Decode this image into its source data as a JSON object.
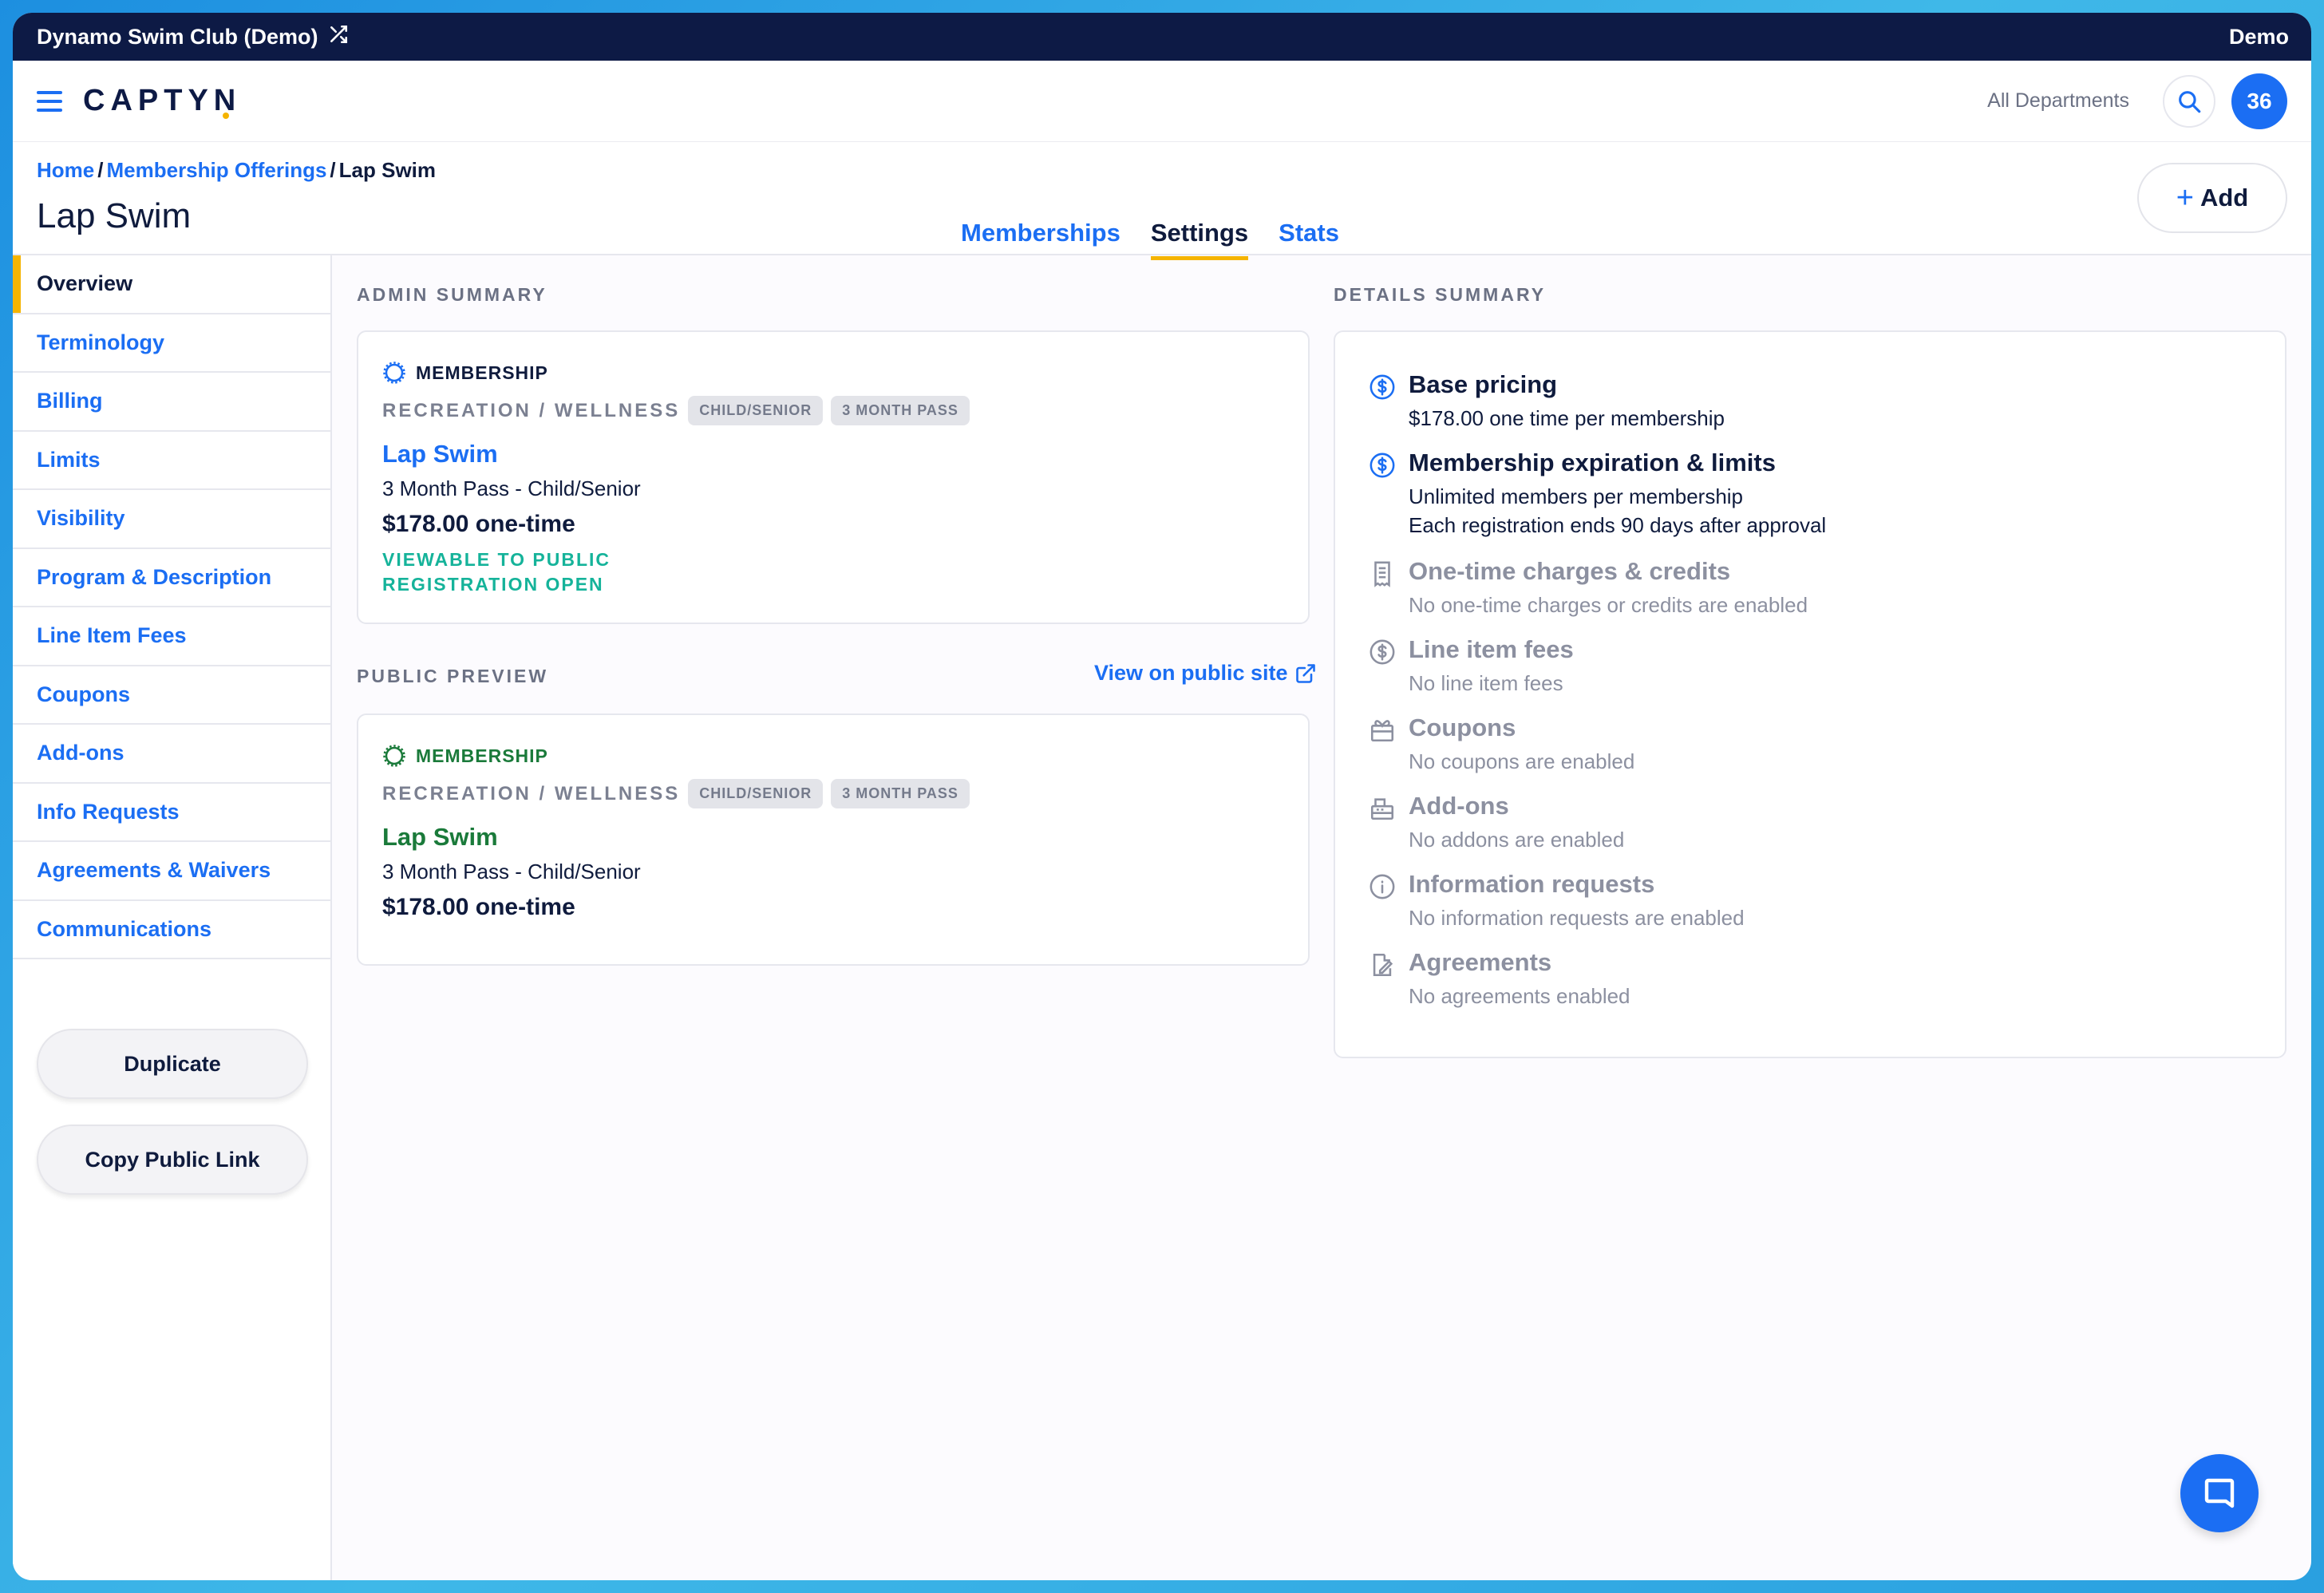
{
  "topbar": {
    "club_name": "Dynamo Swim Club (Demo)",
    "mode": "Demo"
  },
  "appbar": {
    "logo": "CAPTYN",
    "department_filter": "All Departments",
    "notification_count": "36"
  },
  "breadcrumb": {
    "home": "Home",
    "section": "Membership Offerings",
    "current": "Lap Swim"
  },
  "page": {
    "title": "Lap Swim"
  },
  "tabs": [
    {
      "label": "Memberships",
      "active": false
    },
    {
      "label": "Settings",
      "active": true
    },
    {
      "label": "Stats",
      "active": false
    }
  ],
  "add_button": {
    "label": "Add"
  },
  "sidebar": {
    "items": [
      {
        "label": "Overview"
      },
      {
        "label": "Terminology"
      },
      {
        "label": "Billing"
      },
      {
        "label": "Limits"
      },
      {
        "label": "Visibility"
      },
      {
        "label": "Program & Description"
      },
      {
        "label": "Line Item Fees"
      },
      {
        "label": "Coupons"
      },
      {
        "label": "Add-ons"
      },
      {
        "label": "Info Requests"
      },
      {
        "label": "Agreements & Waivers"
      },
      {
        "label": "Communications"
      }
    ],
    "duplicate_label": "Duplicate",
    "copy_link_label": "Copy Public Link"
  },
  "admin_summary": {
    "heading": "ADMIN SUMMARY",
    "type_label": "MEMBERSHIP",
    "category": "RECREATION / WELLNESS",
    "tags": [
      "CHILD/SENIOR",
      "3 MONTH PASS"
    ],
    "title": "Lap Swim",
    "subtitle": "3 Month Pass - Child/Senior",
    "price": "$178.00 one-time",
    "status_visibility": "VIEWABLE TO PUBLIC",
    "status_registration": "REGISTRATION OPEN"
  },
  "public_preview": {
    "heading": "PUBLIC PREVIEW",
    "view_link": "View on public site",
    "type_label": "MEMBERSHIP",
    "category": "RECREATION / WELLNESS",
    "tags": [
      "CHILD/SENIOR",
      "3 MONTH PASS"
    ],
    "title": "Lap Swim",
    "subtitle": "3 Month Pass - Child/Senior",
    "price": "$178.00 one-time"
  },
  "details_summary": {
    "heading": "DETAILS SUMMARY",
    "base_pricing": {
      "title": "Base pricing",
      "text": "$178.00 one time per membership"
    },
    "expiration": {
      "title": "Membership expiration & limits",
      "text1": "Unlimited members per membership",
      "text2": "Each registration ends 90 days after approval"
    },
    "one_time": {
      "title": "One-time charges & credits",
      "text": "No one-time charges or credits are enabled"
    },
    "line_fees": {
      "title": "Line item fees",
      "text": "No line item fees"
    },
    "coupons": {
      "title": "Coupons",
      "text": "No coupons are enabled"
    },
    "addons": {
      "title": "Add-ons",
      "text": "No addons are enabled"
    },
    "info_requests": {
      "title": "Information requests",
      "text": "No information requests are enabled"
    },
    "agreements": {
      "title": "Agreements",
      "text": "No agreements enabled"
    }
  },
  "colors": {
    "accent": "#1b6ef3",
    "navy": "#0d1a45",
    "tab_underline": "#f5b400",
    "status_green": "#15b39a",
    "preview_green": "#1a7a3a"
  }
}
